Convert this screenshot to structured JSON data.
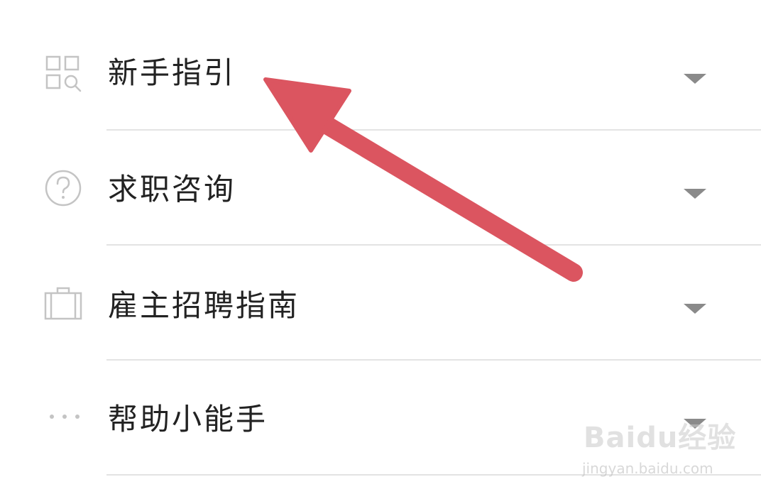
{
  "menu": {
    "items": [
      {
        "label": "新手指引",
        "icon": "guide-grid-search-icon"
      },
      {
        "label": "求职咨询",
        "icon": "question-circle-icon"
      },
      {
        "label": "雇主招聘指南",
        "icon": "briefcase-icon"
      },
      {
        "label": "帮助小能手",
        "icon": "more-dots-icon"
      }
    ]
  },
  "annotation": {
    "arrow_color": "#db5560",
    "arrow_target": "新手指引"
  },
  "watermark": {
    "logo": "Baidu经验",
    "url": "jingyan.baidu.com"
  },
  "colors": {
    "text": "#222222",
    "icon": "#c4c4c4",
    "caret": "#8a8a8a",
    "divider": "#e3e3e3"
  }
}
